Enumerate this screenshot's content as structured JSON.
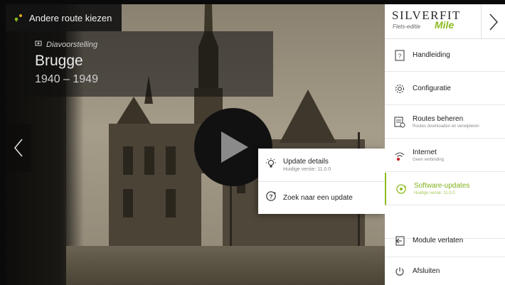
{
  "colors": {
    "accent": "#8dbb1f",
    "panel": "#ffffff",
    "overlay": "#141414"
  },
  "route_button": {
    "label": "Andere route kiezen",
    "icon": "route-pins-icon"
  },
  "slideshow": {
    "label": "Diavoorstelling",
    "city": "Brugge",
    "years": "1940 – 1949"
  },
  "popup": {
    "items": [
      {
        "title": "Update details",
        "subtitle": "Huidige versie: 11.0.0",
        "icon": "lightbulb-icon"
      },
      {
        "title": "Zoek naar een update",
        "subtitle": "",
        "icon": "search-update-icon"
      }
    ]
  },
  "logo": {
    "brand": "SILVERFIT",
    "sub": "Fiets-editie",
    "mile": "Mile"
  },
  "menu": {
    "items": [
      {
        "label": "Handleiding",
        "sub": "",
        "icon": "manual-icon"
      },
      {
        "label": "Configuratie",
        "sub": "",
        "icon": "gear-icon"
      },
      {
        "label": "Routes beheren",
        "sub": "Routes downloaden en verwijderen",
        "icon": "routes-icon"
      },
      {
        "label": "Internet",
        "sub": "Geen verbinding",
        "icon": "wifi-off-icon"
      },
      {
        "label": "Software-updates",
        "sub": "Huidige versie: 11.0.0",
        "icon": "software-update-icon"
      },
      {
        "label": "Module verlaten",
        "sub": "",
        "icon": "exit-module-icon"
      },
      {
        "label": "Afsluiten",
        "sub": "",
        "icon": "power-icon"
      }
    ]
  }
}
